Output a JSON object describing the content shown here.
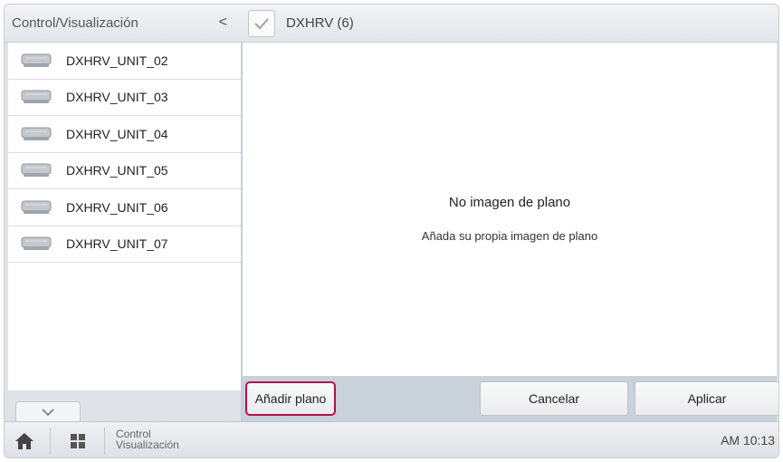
{
  "left_panel": {
    "title": "Control/Visualización",
    "collapse_symbol": "<",
    "units": [
      {
        "label": "DXHRV_UNIT_02",
        "icon": "ventilation-unit-icon"
      },
      {
        "label": "DXHRV_UNIT_03",
        "icon": "ventilation-unit-icon"
      },
      {
        "label": "DXHRV_UNIT_04",
        "icon": "ventilation-unit-icon"
      },
      {
        "label": "DXHRV_UNIT_05",
        "icon": "ventilation-unit-icon"
      },
      {
        "label": "DXHRV_UNIT_06",
        "icon": "ventilation-unit-icon"
      },
      {
        "label": "DXHRV_UNIT_07",
        "icon": "ventilation-unit-icon"
      }
    ]
  },
  "header": {
    "group_title": "DXHRV (6)",
    "check_icon": "checkmark-icon"
  },
  "main": {
    "empty_title": "No imagen de plano",
    "empty_subtitle": "Añada su propia imagen de plano"
  },
  "buttons": {
    "add_plan": "Añadir plano",
    "cancel": "Cancelar",
    "apply": "Aplicar"
  },
  "bottom_bar": {
    "path_line1": "Control",
    "path_line2": "Visualización",
    "clock": "AM 10:13"
  },
  "colors": {
    "highlight": "#b0124d",
    "check": "#9aa3ad",
    "home_icon": "#444444"
  }
}
